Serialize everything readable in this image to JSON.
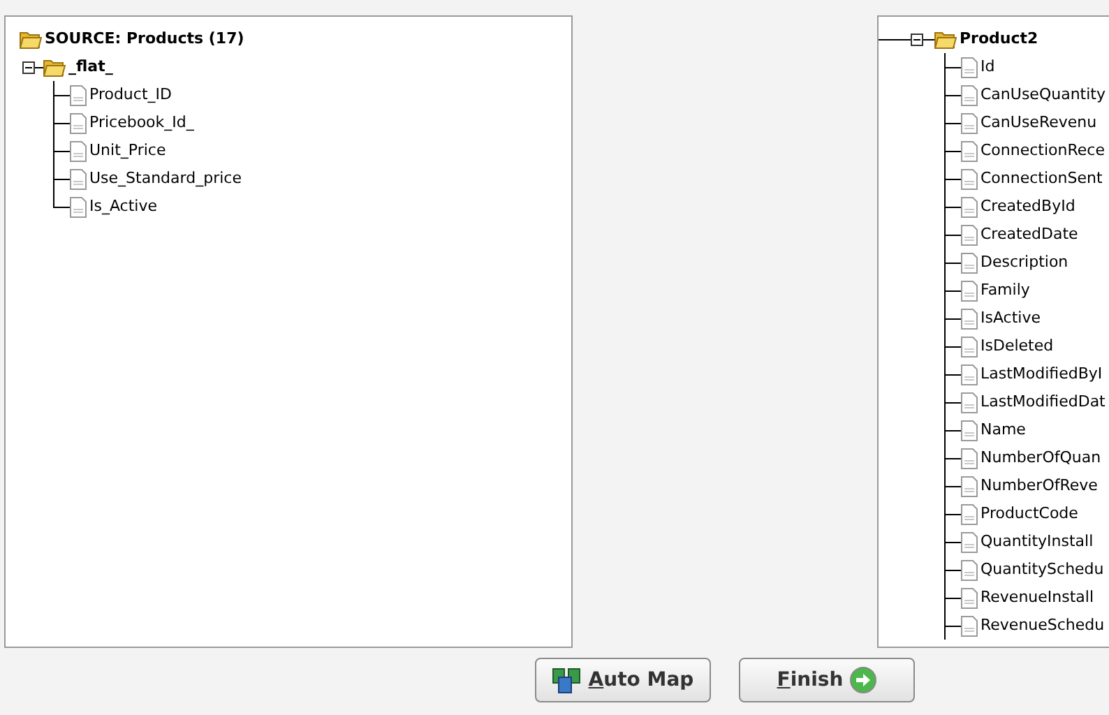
{
  "source_tree": {
    "title": "SOURCE: Products (17)",
    "children": [
      {
        "name": "_flat_",
        "expanded": true,
        "children": [
          {
            "name": "Product_ID"
          },
          {
            "name": "Pricebook_Id_"
          },
          {
            "name": "Unit_Price"
          },
          {
            "name": "Use_Standard_price"
          },
          {
            "name": "Is_Active"
          }
        ]
      }
    ]
  },
  "target_tree": {
    "children": [
      {
        "name": "Product2",
        "expanded": true,
        "children": [
          {
            "name": "Id"
          },
          {
            "name": "CanUseQuantity"
          },
          {
            "name": "CanUseRevenu"
          },
          {
            "name": "ConnectionRece"
          },
          {
            "name": "ConnectionSent"
          },
          {
            "name": "CreatedById"
          },
          {
            "name": "CreatedDate"
          },
          {
            "name": "Description"
          },
          {
            "name": "Family"
          },
          {
            "name": "IsActive"
          },
          {
            "name": "IsDeleted"
          },
          {
            "name": "LastModifiedByI"
          },
          {
            "name": "LastModifiedDat"
          },
          {
            "name": "Name"
          },
          {
            "name": "NumberOfQuan"
          },
          {
            "name": "NumberOfReve"
          },
          {
            "name": "ProductCode"
          },
          {
            "name": "QuantityInstall"
          },
          {
            "name": "QuantitySchedu"
          },
          {
            "name": "RevenueInstall"
          },
          {
            "name": "RevenueSchedu"
          }
        ]
      }
    ]
  },
  "buttons": [
    {
      "kind": "automap",
      "mnemonic": "A",
      "rest": "uto Map"
    },
    {
      "kind": "finish",
      "mnemonic": "F",
      "rest": "inish"
    }
  ]
}
